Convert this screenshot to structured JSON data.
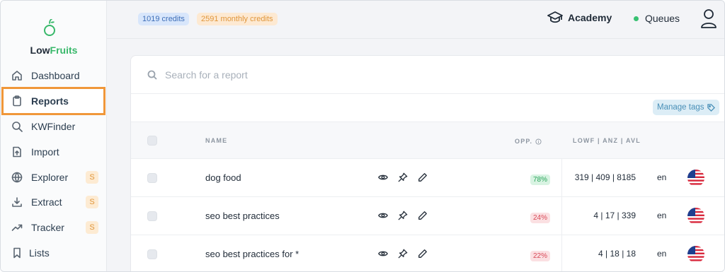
{
  "brand": {
    "name_part1": "Low",
    "name_part2": "Fruits"
  },
  "sidebar": {
    "items": [
      {
        "label": "Dashboard",
        "icon": "home-icon",
        "badge": ""
      },
      {
        "label": "Reports",
        "icon": "clipboard-icon",
        "badge": ""
      },
      {
        "label": "KWFinder",
        "icon": "search-icon",
        "badge": ""
      },
      {
        "label": "Import",
        "icon": "file-upload-icon",
        "badge": ""
      },
      {
        "label": "Explorer",
        "icon": "globe-icon",
        "badge": "S"
      },
      {
        "label": "Extract",
        "icon": "download-icon",
        "badge": "S"
      },
      {
        "label": "Tracker",
        "icon": "trending-up-icon",
        "badge": "S"
      },
      {
        "label": "Lists",
        "icon": "bookmark-icon",
        "badge": ""
      }
    ],
    "highlight_color": "#f0973a"
  },
  "topbar": {
    "credits": "1019 credits",
    "monthly_credits": "2591 monthly credits",
    "academy": "Academy",
    "queues": "Queues"
  },
  "search": {
    "placeholder": "Search for a report",
    "value": ""
  },
  "toolbar": {
    "manage_tags": "Manage tags"
  },
  "table": {
    "columns": {
      "name": "NAME",
      "opp": "OPP.",
      "metrics": "LOWF | ANZ | AVL"
    },
    "rows": [
      {
        "name": "dog food",
        "opp": "78%",
        "opp_color": "green",
        "metrics": "319  | 409 | 8185",
        "lang": "en",
        "flag": "us-flag-icon"
      },
      {
        "name": "seo best practices",
        "opp": "24%",
        "opp_color": "red",
        "metrics": "4  | 17 | 339",
        "lang": "en",
        "flag": "us-flag-icon"
      },
      {
        "name": "seo best practices for *",
        "opp": "22%",
        "opp_color": "red",
        "metrics": "4  | 18 | 18",
        "lang": "en",
        "flag": "us-flag-icon"
      }
    ]
  },
  "colors": {
    "brand_green": "#38b86a",
    "accent_orange": "#f0973a",
    "credits_blue": "#d8e6fb",
    "credits_orange": "#fde9d2"
  }
}
